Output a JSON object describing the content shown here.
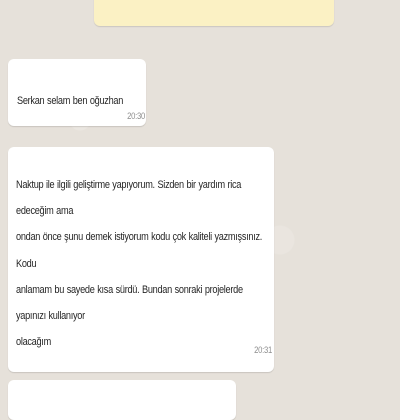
{
  "system_notice": {
    "fragment": "• |"
  },
  "messages": [
    {
      "text": "Serkan selam ben oğuzhan",
      "time": "20:30"
    },
    {
      "text": "Naktup ile ilgili geliştirme yapıyorum. Sizden bir yardım rica edeceğim ama\nondan önce şunu demek istiyorum kodu çok kaliteli yazmışsınız. Kodu\nanlamam bu sayede kısa sürdü. Bundan sonraki projelerde yapınızı kullanıyor\nolacağım",
      "time": "20:31"
    },
    {
      "text": "",
      "time": ""
    }
  ]
}
